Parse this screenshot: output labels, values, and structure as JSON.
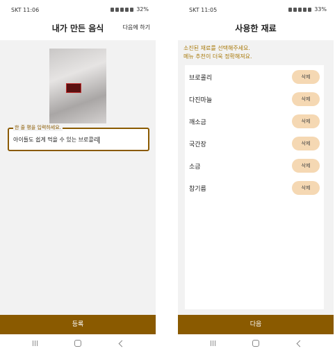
{
  "left": {
    "status": {
      "time": "SKT 11:06",
      "battery": "32%"
    },
    "header": {
      "title": "내가 만든 음식",
      "action": "다음에 하기"
    },
    "caption": {
      "label": "한 줄 평을 입력하세요.",
      "value": "아이들도 쉽게 먹을 수 있는 브로콜리"
    },
    "submit_label": "등록"
  },
  "right": {
    "status": {
      "time": "SKT 11:05",
      "battery": "33%"
    },
    "header": {
      "title": "사용한 재료"
    },
    "notice": {
      "line1": "소진된 재료를 선택해주세요.",
      "line2": "메뉴 추천이 더욱 정확해져요."
    },
    "items": [
      {
        "name": "브로콜리",
        "delete": "삭제"
      },
      {
        "name": "다진마늘",
        "delete": "삭제"
      },
      {
        "name": "깨소금",
        "delete": "삭제"
      },
      {
        "name": "국간장",
        "delete": "삭제"
      },
      {
        "name": "소금",
        "delete": "삭제"
      },
      {
        "name": "참기름",
        "delete": "삭제"
      }
    ],
    "next_label": "다음"
  },
  "colors": {
    "accent": "#8a5a00",
    "delete_pill": "#f5d8b3",
    "notice": "#a8790a",
    "background": "#f2f2f2"
  },
  "icons": {
    "nav": [
      "recent-apps-icon",
      "home-icon",
      "back-icon"
    ]
  }
}
